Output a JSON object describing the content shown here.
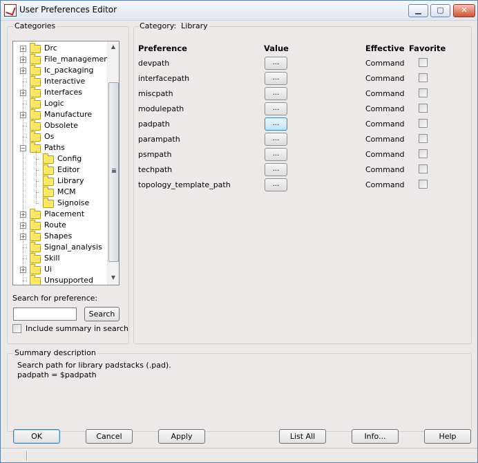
{
  "window": {
    "title": "User Preferences Editor",
    "icon": "app-icon",
    "controls": {
      "minimize": "▁",
      "maximize": "▢",
      "close": "✕"
    }
  },
  "categories": {
    "group_label": "Categories",
    "items": [
      {
        "label": "Drc",
        "expandable": true
      },
      {
        "label": "File_management",
        "expandable": true
      },
      {
        "label": "Ic_packaging",
        "expandable": true
      },
      {
        "label": "Interactive",
        "expandable": false
      },
      {
        "label": "Interfaces",
        "expandable": true
      },
      {
        "label": "Logic",
        "expandable": false
      },
      {
        "label": "Manufacture",
        "expandable": true
      },
      {
        "label": "Obsolete",
        "expandable": false
      },
      {
        "label": "Os",
        "expandable": false
      },
      {
        "label": "Paths",
        "expandable": true,
        "expanded": true,
        "children": [
          "Config",
          "Editor",
          "Library",
          "MCM",
          "Signoise"
        ]
      },
      {
        "label": "Placement",
        "expandable": true
      },
      {
        "label": "Route",
        "expandable": true
      },
      {
        "label": "Shapes",
        "expandable": true
      },
      {
        "label": "Signal_analysis",
        "expandable": false
      },
      {
        "label": "Skill",
        "expandable": false
      },
      {
        "label": "Ui",
        "expandable": true
      },
      {
        "label": "Unsupported",
        "expandable": false
      }
    ]
  },
  "search": {
    "label": "Search for preference:",
    "value": "",
    "button": "Search",
    "include_summary_label": "Include summary in search",
    "include_summary_checked": false
  },
  "category_panel": {
    "label_prefix": "Category:",
    "category": "Library",
    "headers": {
      "preference": "Preference",
      "value": "Value",
      "effective": "Effective",
      "favorite": "Favorite"
    },
    "rows": [
      {
        "preference": "devpath",
        "value_button": "...",
        "effective": "Command",
        "favorite": false
      },
      {
        "preference": "interfacepath",
        "value_button": "...",
        "effective": "Command",
        "favorite": false
      },
      {
        "preference": "miscpath",
        "value_button": "...",
        "effective": "Command",
        "favorite": false
      },
      {
        "preference": "modulepath",
        "value_button": "...",
        "effective": "Command",
        "favorite": false
      },
      {
        "preference": "padpath",
        "value_button": "...",
        "effective": "Command",
        "favorite": false,
        "focused": true
      },
      {
        "preference": "parampath",
        "value_button": "...",
        "effective": "Command",
        "favorite": false
      },
      {
        "preference": "psmpath",
        "value_button": "...",
        "effective": "Command",
        "favorite": false
      },
      {
        "preference": "techpath",
        "value_button": "...",
        "effective": "Command",
        "favorite": false
      },
      {
        "preference": "topology_template_path",
        "value_button": "...",
        "effective": "Command",
        "favorite": false
      }
    ]
  },
  "summary": {
    "label": "Summary description",
    "line1": "Search path for library padstacks (.pad).",
    "line2": "padpath = $padpath"
  },
  "footer": {
    "ok": "OK",
    "cancel": "Cancel",
    "apply": "Apply",
    "list_all": "List All",
    "info": "Info...",
    "help": "Help"
  }
}
